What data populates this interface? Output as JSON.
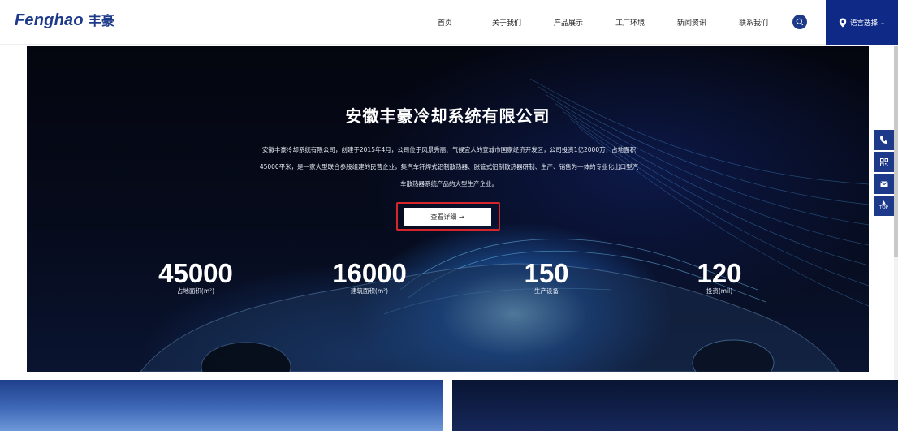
{
  "header": {
    "logo_en": "Fenghao",
    "logo_cn": "丰豪",
    "nav": [
      "首页",
      "关于我们",
      "产品展示",
      "工厂环境",
      "新闻资讯",
      "联系我们"
    ],
    "language_label": "语言选择"
  },
  "hero": {
    "title": "安徽丰豪冷却系统有限公司",
    "description_lines": [
      "安徽丰豪冷却系统有限公司，创建于2015年4月，公司位于风景秀丽、气候宜人的宣城市国家经济开发区，公司投资1亿2000万，占地面积",
      "45000平米，是一家大型联合参股组建的民营企业，集汽车钎焊式铝制散热器、胀管式铝制散热器研制、生产、销售为一体的专业化出口型汽",
      "车散热器系统产品的大型生产企业。"
    ],
    "detail_button": "查看详细 →",
    "stats": [
      {
        "value": "45000",
        "label": "占地面积(m²)"
      },
      {
        "value": "16000",
        "label": "建筑面积(m²)"
      },
      {
        "value": "150",
        "label": "生产设备"
      },
      {
        "value": "120",
        "label": "投资(mil)"
      }
    ]
  },
  "sidebar": {
    "top_label": "TOP"
  },
  "colors": {
    "brand": "#1d3a8a",
    "lang_bg": "#0f2a86",
    "highlight": "#d7262b"
  }
}
